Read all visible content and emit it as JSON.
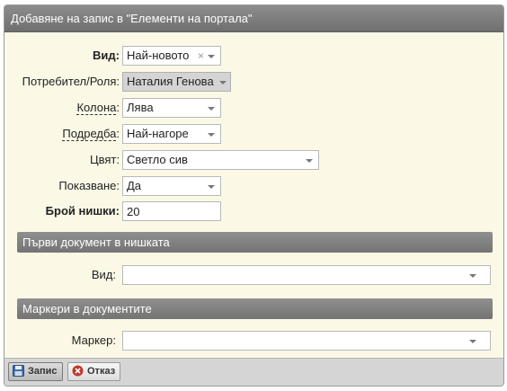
{
  "dialog": {
    "title": "Добавяне на запис в \"Елементи на портала\""
  },
  "form": {
    "vid": {
      "label": "Вид:",
      "value": "Най-новото",
      "clear": "×"
    },
    "user_role": {
      "label": "Потребител/Роля:",
      "value": "Наталия Генова"
    },
    "kolona": {
      "label": "Колона",
      "colon": ":",
      "value": "Лява"
    },
    "podredba": {
      "label": "Подредба",
      "colon": ":",
      "value": "Най-нагоре"
    },
    "cvyat": {
      "label": "Цвят:",
      "value": "Светло сив"
    },
    "pokazvane": {
      "label": "Показване:",
      "value": "Да"
    },
    "broy_nishki": {
      "label": "Брой нишки:",
      "value": "20"
    }
  },
  "sections": {
    "first_doc": {
      "title": "Първи документ в нишката",
      "vid_label": "Вид:",
      "vid_value": ""
    },
    "markers": {
      "title": "Маркери в документите",
      "marker_label": "Маркер:",
      "marker_value": ""
    }
  },
  "footer": {
    "save_label": "Запис",
    "cancel_label": "Отказ"
  },
  "colors": {
    "titlebar": "#7e7e7e",
    "panel_bg": "#fbf9e6",
    "cancel_icon": "#c0392b"
  },
  "icons": {
    "save": "floppy-disk-icon",
    "cancel": "cancel-circle-icon"
  }
}
